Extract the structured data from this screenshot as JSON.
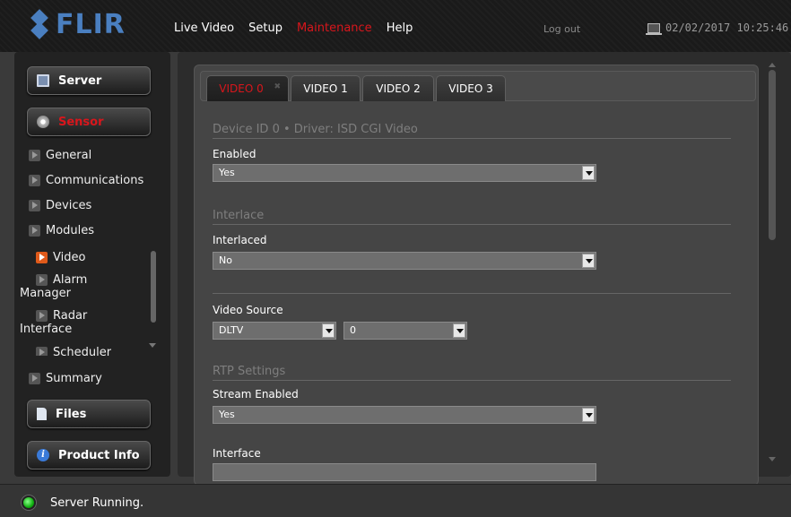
{
  "header": {
    "logo_text": "FLIR",
    "nav": [
      "Live Video",
      "Setup",
      "Maintenance",
      "Help"
    ],
    "active_nav": "Maintenance",
    "logout": "Log out",
    "datetime": "02/02/2017 10:25:46 am"
  },
  "sidebar": {
    "server_button": "Server",
    "sensor_button": "Sensor",
    "items": [
      "General",
      "Communications",
      "Devices",
      "Modules"
    ],
    "sub_items": [
      "Video",
      "Alarm Manager",
      "Radar Interface",
      "Scheduler"
    ],
    "active_sub": "Video",
    "summary": "Summary",
    "files_button": "Files",
    "product_info_button": "Product Info"
  },
  "main": {
    "tabs": [
      "VIDEO 0",
      "VIDEO 1",
      "VIDEO 2",
      "VIDEO 3"
    ],
    "active_tab": "VIDEO 0",
    "device_section": "Device ID 0  •  Driver: ISD CGI Video",
    "enabled_label": "Enabled",
    "enabled_value": "Yes",
    "interlace_section": "Interlace",
    "interlaced_label": "Interlaced",
    "interlaced_value": "No",
    "video_source_label": "Video Source",
    "video_source_value": "DLTV",
    "video_source_index": "0",
    "rtp_section": "RTP Settings",
    "stream_enabled_label": "Stream Enabled",
    "stream_enabled_value": "Yes",
    "interface_label": "Interface"
  },
  "footer": {
    "status": "Server Running."
  },
  "colors": {
    "accent_red": "#d9161c",
    "logo_blue": "#4a7fc0",
    "status_green": "#10b010"
  }
}
